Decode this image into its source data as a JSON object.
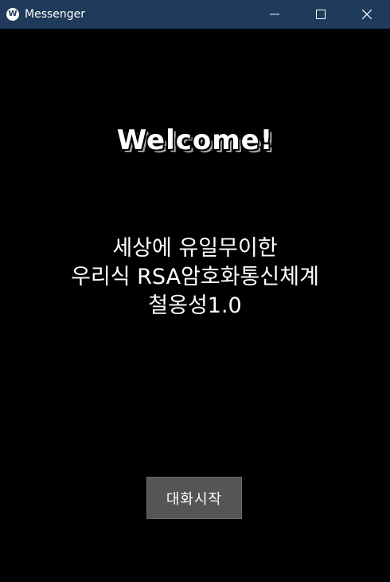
{
  "window": {
    "title": "Messenger",
    "icon": "messenger-w-icon",
    "icon_glyph": "W",
    "controls": {
      "minimize": "minimize-icon",
      "maximize": "maximize-icon",
      "close": "close-icon"
    },
    "titlebar_color": "#1f3a5a"
  },
  "main": {
    "heading": "Welcome!",
    "description": {
      "line1": "세상에 유일무이한",
      "line2": "우리식 RSA암호화통신체계",
      "line3": "철옹성1.0"
    },
    "start_button": "대화시작"
  },
  "colors": {
    "background": "#000000",
    "button": "#555555",
    "text": "#ffffff"
  }
}
